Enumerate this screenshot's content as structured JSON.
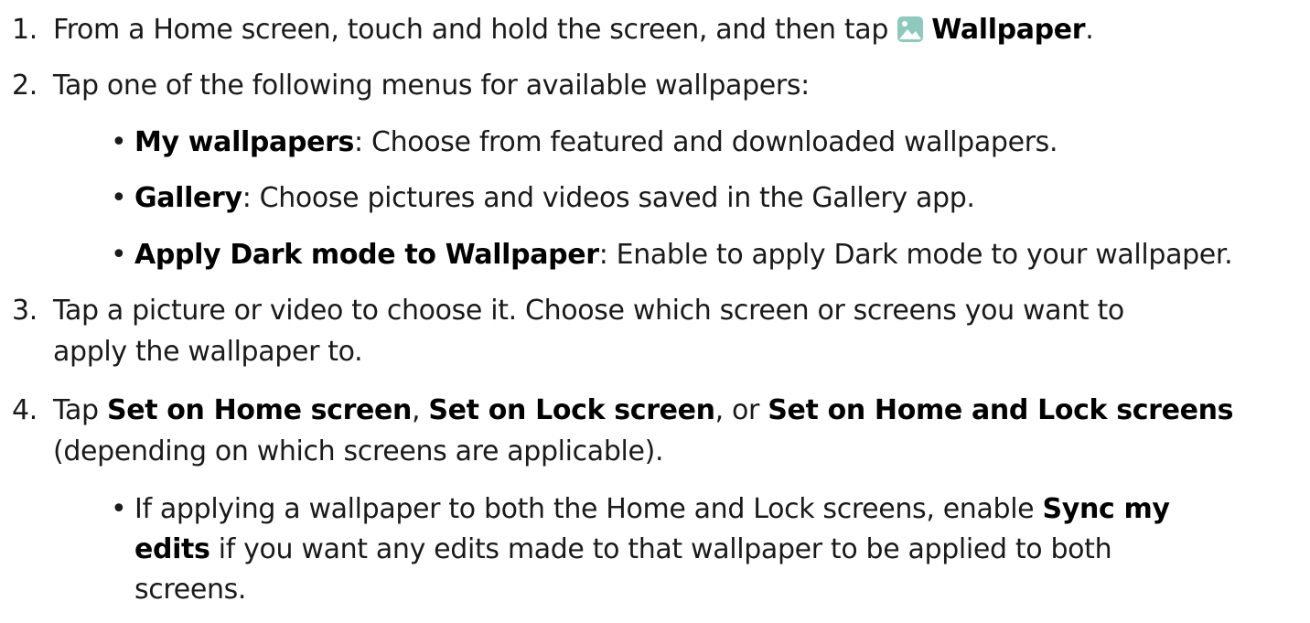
{
  "steps": [
    {
      "number": "1.",
      "parts": [
        "From a Home screen, touch and hold the screen, and then tap ",
        "Wallpaper",
        "."
      ],
      "icon": "wallpaper-icon"
    },
    {
      "number": "2.",
      "text": "Tap one of the following menus for available wallpapers:",
      "bullets": [
        {
          "term": "My wallpapers",
          "desc": ": Choose from featured and downloaded wallpapers."
        },
        {
          "term": "Gallery",
          "desc": ": Choose pictures and videos saved in the Gallery app."
        },
        {
          "term": "Apply Dark mode to Wallpaper",
          "desc": ": Enable to apply Dark mode to your wallpaper."
        }
      ]
    },
    {
      "number": "3.",
      "lines": [
        "Tap a picture or video to choose it. Choose which screen or screens you want to",
        "apply the wallpaper to."
      ]
    },
    {
      "number": "4.",
      "parts": [
        "Tap ",
        "Set on Home screen",
        ", ",
        "Set on Lock screen",
        ", or ",
        "Set on Home and Lock screens",
        "(depending on which screens are applicable)."
      ],
      "bullet": {
        "parts": [
          "If applying a wallpaper to both the Home and Lock screens, enable ",
          "Sync my",
          "edits",
          " if you want any edits made to that wallpaper to be applied to both",
          "screens."
        ]
      }
    }
  ],
  "bullet_char": "•",
  "colors": {
    "text": "#1a1a1a",
    "emphasis": "#000000",
    "icon_bg": "#8fc9bd",
    "icon_fg": "#ffffff"
  }
}
